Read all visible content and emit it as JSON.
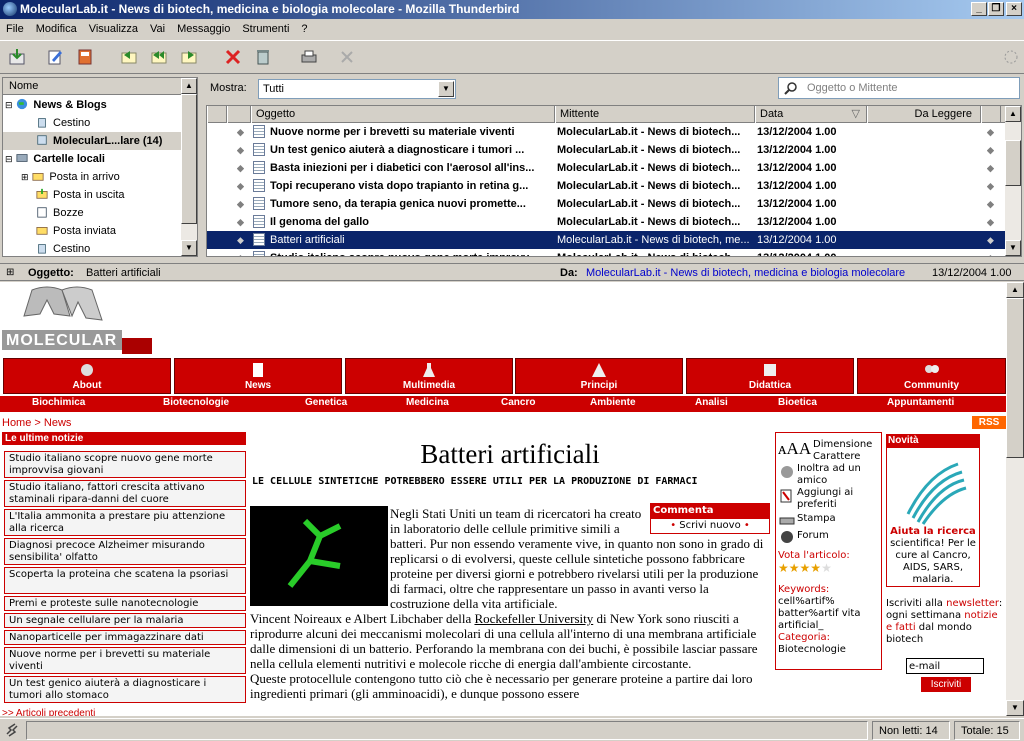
{
  "window": {
    "title": "MolecularLab.it - News di biotech, medicina e biologia molecolare - Mozilla Thunderbird"
  },
  "menu": [
    "File",
    "Modifica",
    "Visualizza",
    "Vai",
    "Messaggio",
    "Strumenti",
    "?"
  ],
  "folders": {
    "header": "Nome",
    "items": [
      {
        "label": "News & Blogs",
        "bold": true
      },
      {
        "label": "Cestino",
        "bold": false
      },
      {
        "label": "MolecularL...lare (14)",
        "bold": true
      },
      {
        "label": "Cartelle locali",
        "bold": true
      },
      {
        "label": "Posta in arrivo",
        "bold": false
      },
      {
        "label": "Posta in uscita",
        "bold": false
      },
      {
        "label": "Bozze",
        "bold": false
      },
      {
        "label": "Posta inviata",
        "bold": false
      },
      {
        "label": "Cestino",
        "bold": false
      }
    ]
  },
  "filter": {
    "label": "Mostra:",
    "value": "Tutti",
    "search_placeholder": "Oggetto o Mittente"
  },
  "threads": {
    "columns": {
      "subject": "Oggetto",
      "sender": "Mittente",
      "date": "Data",
      "unread": "Da Leggere"
    },
    "rows": [
      {
        "subject": "Nuove norme per i brevetti su materiale viventi",
        "sender": "MolecularLab.it - News di biotech...",
        "date": "13/12/2004 1.00"
      },
      {
        "subject": "Un test genico aiuterà a diagnosticare i tumori ...",
        "sender": "MolecularLab.it - News di biotech...",
        "date": "13/12/2004 1.00"
      },
      {
        "subject": "Basta iniezioni per i diabetici con l'aerosol all'ins...",
        "sender": "MolecularLab.it - News di biotech...",
        "date": "13/12/2004 1.00"
      },
      {
        "subject": "Topi recuperano vista dopo trapianto in retina g...",
        "sender": "MolecularLab.it - News di biotech...",
        "date": "13/12/2004 1.00"
      },
      {
        "subject": "Tumore seno, da terapia genica nuovi promette...",
        "sender": "MolecularLab.it - News di biotech...",
        "date": "13/12/2004 1.00"
      },
      {
        "subject": "Il genoma del gallo",
        "sender": "MolecularLab.it - News di biotech...",
        "date": "13/12/2004 1.00"
      },
      {
        "subject": "Batteri artificiali",
        "sender": "MolecularLab.it - News di biotech, me...",
        "date": "13/12/2004 1.00"
      },
      {
        "subject": "Studio italiano scopre nuovo gene morte improvv...",
        "sender": "MolecularLab.it - News di biotech...",
        "date": "13/12/2004 1.00"
      }
    ]
  },
  "msgheader": {
    "subject_label": "Oggetto:",
    "subject": "Batteri artificiali",
    "from_label": "Da:",
    "from": "MolecularLab.it - News di biotech, medicina e biologia molecolare",
    "date": "13/12/2004 1.00"
  },
  "site": {
    "logo_text": "MOLECULAR LAB",
    "nav": [
      "About",
      "News",
      "Multimedia",
      "Principi",
      "Didattica",
      "Community"
    ],
    "categories": [
      "Biochimica",
      "Biotecnologie",
      "Genetica",
      "Medicina",
      "Cancro",
      "Ambiente",
      "Analisi",
      "Bioetica",
      "Appuntamenti"
    ],
    "breadcrumb": {
      "home": "Home",
      "sep": " > ",
      "current": "News"
    },
    "rss": "RSS",
    "latest_title": "Le ultime notizie",
    "latest": [
      "Studio italiano scopre nuovo gene morte improvvisa giovani",
      "Studio italiano, fattori crescita attivano staminali ripara-danni del cuore",
      "L'Italia ammonita a prestare piu attenzione alla ricerca",
      "Diagnosi precoce Alzheimer misurando sensibilita' olfatto",
      "Scoperta la proteina che scatena la psoriasi",
      "Premi e proteste sulle nanotecnologie",
      "Un segnale cellulare per la malaria",
      "Nanoparticelle per immagazzinare dati",
      "Nuove norme per i brevetti su materiale viventi",
      "Un test genico aiuterà a diagnosticare i tumori allo stomaco"
    ],
    "previous": ">> Articoli precedenti",
    "article": {
      "title": "Batteri artificiali",
      "subtitle": "LE CELLULE SINTETICHE POTREBBERO ESSERE UTILI PER LA PRODUZIONE DI FARMACI",
      "p1": "Negli Stati Uniti un team di ricercatori ha creato in laboratorio delle cellule primitive simili a batteri. Pur non essendo veramente vive, in quanto non sono in grado di replicarsi o di evolversi, queste cellule sintetiche possono fabbricare proteine per diversi giorni e potrebbero rivelarsi utili per la produzione di farmaci, oltre che rappresentare un passo in avanti verso la costruzione della vita artificiale.",
      "p2a": "Vincent Noireaux e Albert Libchaber della ",
      "p2link": "Rockefeller University",
      "p2b": " di New York sono riusciti a riprodurre alcuni dei meccanismi molecolari di una cellula all'interno di una membrana artificiale dalle dimensioni di un batterio. Perforando la membrana con dei buchi, è possibile lasciar passare nella cellula elementi nutritivi e molecole ricche di energia dall'ambiente circostante.",
      "p3": "Queste protocellule contengono tutto ciò che è necessario per generare proteine a partire dai loro ingredienti primari (gli amminoacidi), e dunque possono essere"
    },
    "comment": {
      "title": "Commenta",
      "link": "Scrivi nuovo"
    },
    "tools": {
      "font": "Dimensione Carattere",
      "invite": "Inoltra ad un amico",
      "fav": "Aggiungi ai preferiti",
      "print": "Stampa",
      "forum": "Forum",
      "vote_label": "Vota l'articolo:",
      "rating": 4,
      "rating_max": 5,
      "keywords_label": "Keywords:",
      "keywords": "cell%artif% batter%artif vita artificial_",
      "category_label": "Categoria:",
      "category": "Biotecnologie"
    },
    "novita": {
      "title": "Novità",
      "caption": "Aiuta la ricerca",
      "text": "scientifica! Per le cure al Cancro, AIDS, SARS, malaria.",
      "newsletter_a": "Iscriviti alla ",
      "newsletter_link": "newsletter",
      "newsletter_b": ": ogni settimana ",
      "newsletter_link2": "notizie e fatti",
      "newsletter_c": " dal mondo biotech",
      "email_placeholder": "e-mail",
      "subscribe": "Iscriviti"
    }
  },
  "status": {
    "unread": "Non letti: 14",
    "total": "Totale: 15"
  }
}
